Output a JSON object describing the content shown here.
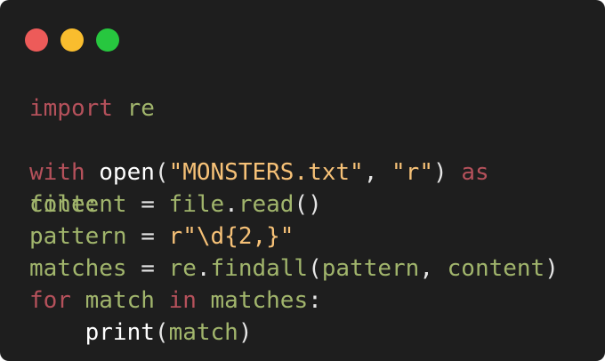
{
  "window": {
    "controls": [
      {
        "name": "close",
        "color": "#ed5b59"
      },
      {
        "name": "minimize",
        "color": "#f9bd2e"
      },
      {
        "name": "maximize",
        "color": "#27c73f"
      }
    ]
  },
  "code": {
    "line1": {
      "kw": "import",
      "mod": "re"
    },
    "line3": {
      "kw": "with",
      "fn": "open",
      "paren_open": "(",
      "str1": "\"MONSTERS.txt\"",
      "comma": ", ",
      "str2": "\"r\"",
      "paren_close": ")",
      "as": "as"
    },
    "line4": {
      "under": "file:",
      "var": "content",
      "eq": " = ",
      "obj": "file",
      "dot": ".",
      "method": "read",
      "parens": "()"
    },
    "line5": {
      "var": "pattern",
      "eq": " = ",
      "str": "r\"\\d{2,}\""
    },
    "line6": {
      "var": "matches",
      "eq": " = ",
      "mod": "re",
      "dot": ".",
      "method": "findall",
      "paren_open": "(",
      "arg1": "pattern",
      "comma": ", ",
      "arg2": "content",
      "paren_close": ")"
    },
    "line7": {
      "kw_for": "for",
      "var": "match",
      "kw_in": "in",
      "iter": "matches",
      "colon": ":"
    },
    "line8": {
      "indent": "    ",
      "fn": "print",
      "paren_open": "(",
      "arg": "match",
      "paren_close": ")"
    }
  }
}
